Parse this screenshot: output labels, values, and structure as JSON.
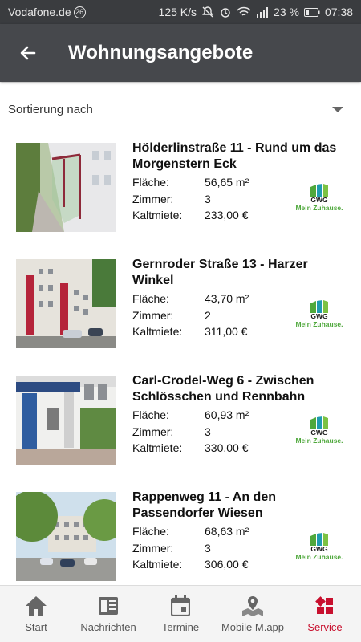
{
  "status_bar": {
    "carrier": "Vodafone.de",
    "carrier_badge": "26",
    "speed": "125 K/s",
    "battery": "23 %",
    "time": "07:38"
  },
  "app_bar": {
    "title": "Wohnungsangebote",
    "back_icon": "arrow-left-icon"
  },
  "sort": {
    "label": "Sortierung nach"
  },
  "labels": {
    "area": "Fläche:",
    "rooms": "Zimmer:",
    "rent": "Kaltmiete:"
  },
  "logo": {
    "brand": "GWG",
    "slogan": "Mein Zuhause.",
    "green": "#4fa83c",
    "teal": "#1f9bb0"
  },
  "listings": [
    {
      "title": "Hölderlinstraße 11 - Rund um das Morgenstern Eck",
      "area": "56,65 m²",
      "rooms": "3",
      "rent": "233,00 €"
    },
    {
      "title": "Gernroder Straße 13 - Harzer Winkel",
      "area": "43,70 m²",
      "rooms": "2",
      "rent": "311,00 €"
    },
    {
      "title": "Carl-Crodel-Weg 6 - Zwischen Schlösschen und Rennbahn",
      "area": "60,93 m²",
      "rooms": "3",
      "rent": "330,00 €"
    },
    {
      "title": "Rappenweg 11 - An den Passendorfer Wiesen",
      "area": "68,63 m²",
      "rooms": "3",
      "rent": "306,00 €"
    }
  ],
  "tabs": [
    {
      "label": "Start",
      "icon": "home-icon"
    },
    {
      "label": "Nachrichten",
      "icon": "newspaper-icon"
    },
    {
      "label": "Termine",
      "icon": "calendar-icon"
    },
    {
      "label": "Mobile M.app",
      "icon": "map-pin-icon"
    },
    {
      "label": "Service",
      "icon": "service-icon",
      "active": true
    }
  ],
  "colors": {
    "app_bar": "#46484c",
    "status_bar": "#3a3c3f",
    "accent": "#c8102e"
  }
}
